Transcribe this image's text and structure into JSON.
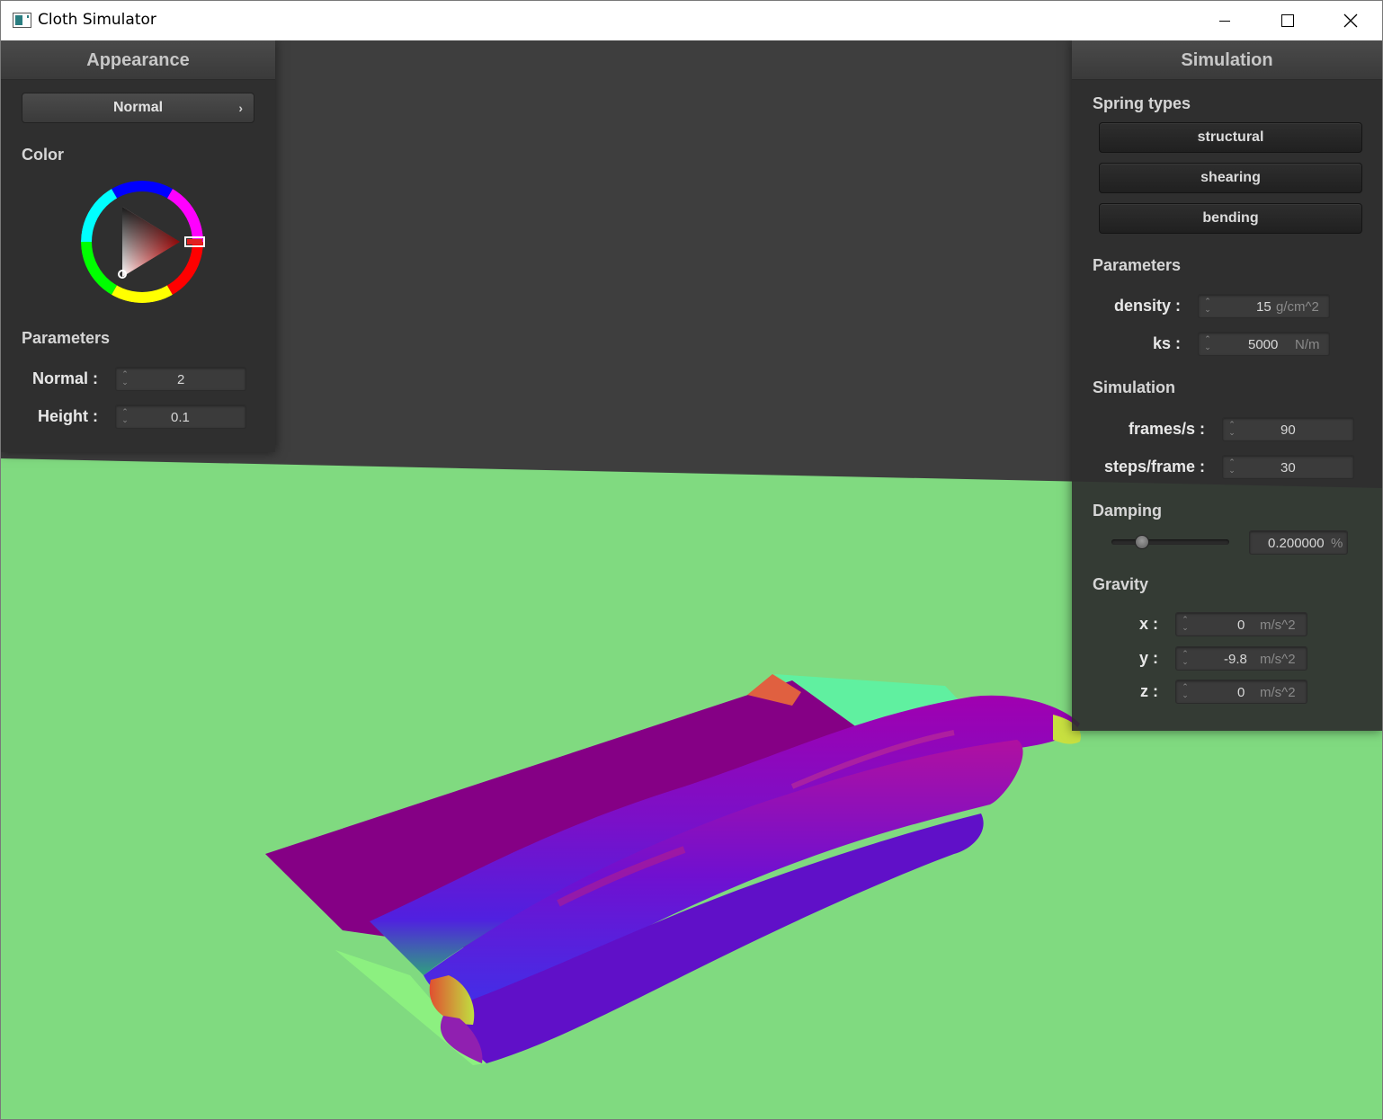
{
  "window": {
    "title": "Cloth Simulator"
  },
  "appearance": {
    "header": "Appearance",
    "shader_dropdown": "Normal",
    "color_label": "Color",
    "params_label": "Parameters",
    "normal_label": "Normal :",
    "normal_value": "2",
    "height_label": "Height :",
    "height_value": "0.1",
    "selected_color": "#e02020"
  },
  "simulation": {
    "header": "Simulation",
    "spring_types_label": "Spring types",
    "spring_types": [
      "structural",
      "shearing",
      "bending"
    ],
    "params_label": "Parameters",
    "density_label": "density :",
    "density_value": "15",
    "density_unit": "g/cm^2",
    "ks_label": "ks :",
    "ks_value": "5000",
    "ks_unit": "N/m",
    "sim_label": "Simulation",
    "fps_label": "frames/s :",
    "fps_value": "90",
    "steps_label": "steps/frame :",
    "steps_value": "30",
    "damping_label": "Damping",
    "damping_value": "0.200000",
    "damping_unit": "%",
    "damping_fraction": 0.2,
    "gravity_label": "Gravity",
    "gx_label": "x :",
    "gx_value": "0",
    "gy_label": "y :",
    "gy_value": "-9.8",
    "gz_label": "z :",
    "gz_value": "0",
    "gravity_unit": "m/s^2"
  },
  "scene": {
    "floor_color": "#80da80",
    "background_color": "#3e3e3e",
    "cloth_color": "#820082"
  }
}
